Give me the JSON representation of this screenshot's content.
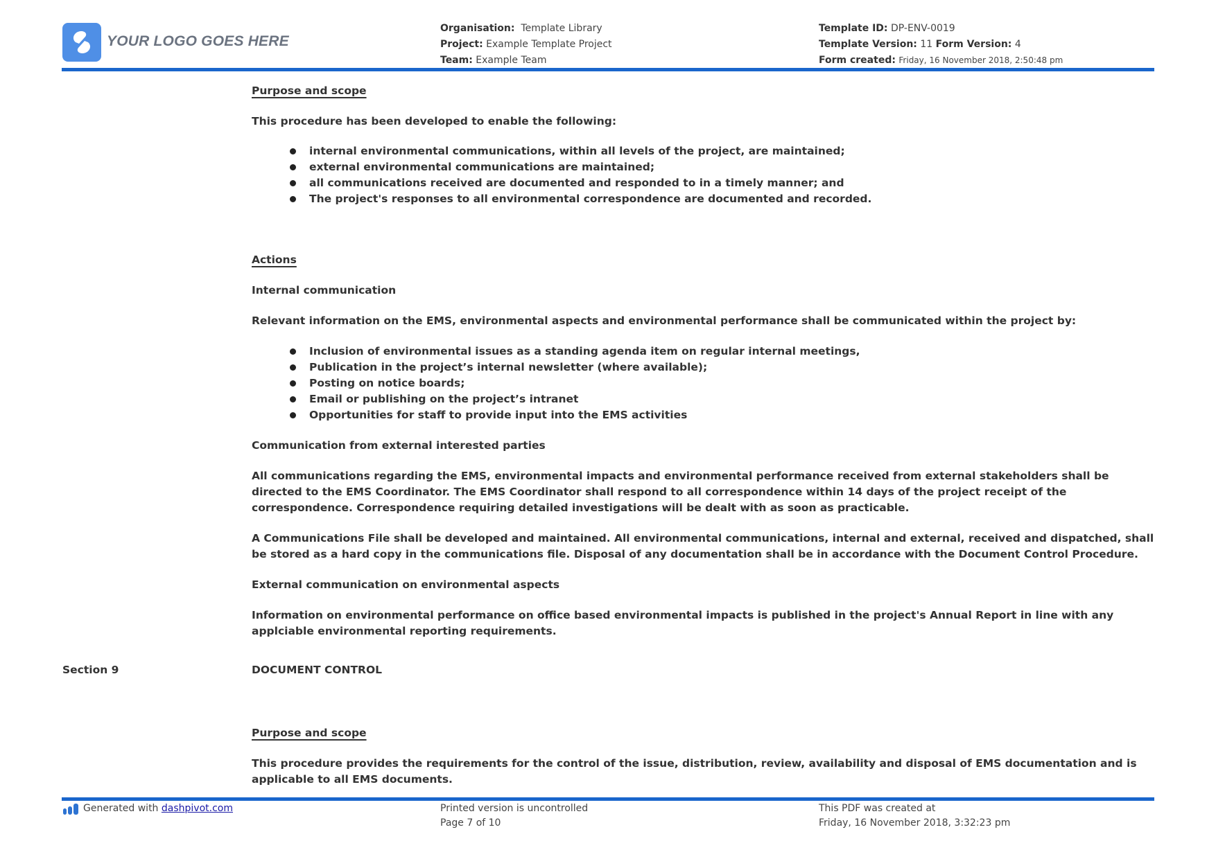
{
  "header": {
    "logo_text": "YOUR LOGO GOES HERE",
    "organisation_label": "Organisation:",
    "organisation_value": "Template Library",
    "project_label": "Project:",
    "project_value": "Example Template Project",
    "team_label": "Team:",
    "team_value": "Example Team",
    "template_id_label": "Template ID:",
    "template_id_value": "DP-ENV-0019",
    "template_version_label": "Template Version:",
    "template_version_value": "11",
    "form_version_label": "Form Version:",
    "form_version_value": "4",
    "form_created_label": "Form created:",
    "form_created_value": "Friday, 16 November 2018, 2:50:48 pm",
    "brand_color": "#1a66cc"
  },
  "section8": {
    "purpose_heading": "Purpose and scope",
    "purpose_intro": "This procedure has been developed to enable the following:",
    "purpose_bullets": [
      "internal environmental communications, within all levels of the project, are maintained;",
      "external environmental communications are maintained;",
      "all communications received are documented and responded to in a timely manner; and",
      "The project's responses to all environmental correspondence are documented and recorded."
    ],
    "actions_heading": "Actions",
    "internal_heading": "Internal communication",
    "internal_intro": "Relevant information on the EMS, environmental aspects and environmental performance shall be communicated within the project by:",
    "internal_bullets": [
      "Inclusion of environmental issues as a standing agenda item on regular internal meetings,",
      "Publication in the project’s internal newsletter (where available);",
      "Posting on notice boards;",
      "Email or publishing on the project’s intranet",
      "Opportunities for staff to provide input into the EMS activities"
    ],
    "external_parties_heading": "Communication from external interested parties",
    "external_parties_para1": "All communications regarding the EMS, environmental impacts and environmental performance received from external stakeholders shall be directed to the EMS Coordinator. The EMS Coordinator shall respond to all correspondence within 14 days of the project receipt of the correspondence. Correspondence requiring detailed investigations will be dealt with as soon as practicable.",
    "external_parties_para2": "A Communications File shall be developed and maintained. All environmental communications, internal and external, received and dispatched, shall be stored as a hard copy in the communications file. Disposal of any documentation shall be in accordance with the Document Control Procedure.",
    "external_aspects_heading": "External communication on environmental aspects",
    "external_aspects_para": "Information on environmental performance on office based environmental impacts is published in the project's Annual Report in line with any applciable environmental reporting requirements."
  },
  "section9": {
    "label": "Section 9",
    "title": "DOCUMENT CONTROL",
    "purpose_heading": "Purpose and scope",
    "purpose_para": "This procedure provides the requirements for the control of the issue, distribution, review, availability and disposal of EMS documentation and is applicable to all EMS documents."
  },
  "footer": {
    "generated_prefix": "Generated with ",
    "generated_link": "dashpivot.com",
    "uncontrolled": "Printed version is uncontrolled",
    "page_info": "Page 7 of 10",
    "pdf_created_label": "This PDF was created at",
    "pdf_created_value": "Friday, 16 November 2018, 3:32:23 pm"
  }
}
